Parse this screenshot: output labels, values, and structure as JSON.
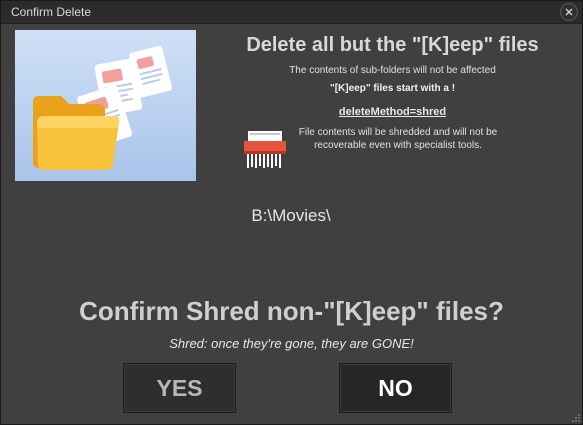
{
  "window": {
    "title": "Confirm Delete",
    "close_icon": "close-icon"
  },
  "illustration": {
    "icon": "folder-with-documents-icon"
  },
  "header": {
    "heading": "Delete all but the \"[K]eep\" files",
    "subfolder_note": "The contents of sub-folders will not be affected",
    "keep_note": "\"[K]eep\" files start with a !"
  },
  "method": {
    "label": "deleteMethod=shred",
    "icon": "shredder-icon",
    "description": "File contents will be shredded and will not be recoverable even with specialist tools."
  },
  "target": {
    "path": "B:\\Movies\\"
  },
  "confirm": {
    "question": "Confirm Shred non-\"[K]eep\" files?",
    "warning": "Shred: once they're gone, they are GONE!"
  },
  "buttons": {
    "yes_label": "YES",
    "no_label": "NO"
  },
  "colors": {
    "background": "#404040",
    "titlebar": "#2b2b2b",
    "button_bg": "#2e2e2e",
    "shredder_red": "#e4563c",
    "folder_yellow": "#f6b92e"
  }
}
